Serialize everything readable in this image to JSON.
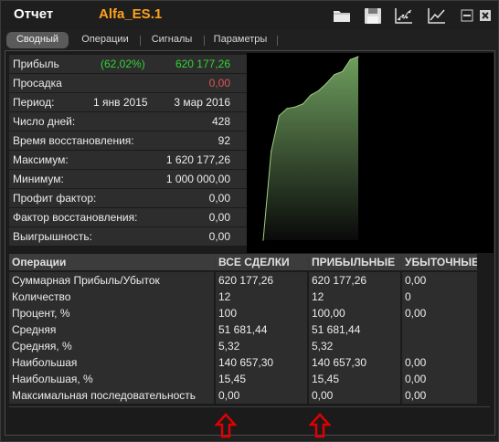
{
  "window": {
    "title": "Отчет",
    "subtitle": "Alfa_ES.1"
  },
  "toolbar_icons": [
    "folder-icon",
    "save-icon",
    "scatter-chart-icon",
    "line-chart-icon"
  ],
  "tabs": [
    {
      "label": "Сводный",
      "active": true
    },
    {
      "label": "Операции",
      "active": false
    },
    {
      "label": "Сигналы",
      "active": false
    },
    {
      "label": "Параметры",
      "active": false
    }
  ],
  "summary": [
    {
      "label": "Прибыль",
      "mid": "(62,02%)",
      "value": "620 177,26",
      "style": "green"
    },
    {
      "label": "Просадка",
      "mid": "",
      "value": "0,00",
      "style": "red"
    },
    {
      "label": "Период:",
      "mid": "1 янв 2015",
      "value": "3 мар 2016",
      "style": ""
    },
    {
      "label": "Число дней:",
      "mid": "",
      "value": "428",
      "style": ""
    },
    {
      "label": "Время восстановления:",
      "mid": "",
      "value": "92",
      "style": ""
    },
    {
      "label": "Максимум:",
      "mid": "",
      "value": "1 620 177,26",
      "style": ""
    },
    {
      "label": "Минимум:",
      "mid": "",
      "value": "1 000 000,00",
      "style": ""
    },
    {
      "label": "Профит фактор:",
      "mid": "",
      "value": "0,00",
      "style": ""
    },
    {
      "label": "Фактор восстановления:",
      "mid": "",
      "value": "0,00",
      "style": ""
    },
    {
      "label": "Выигрышность:",
      "mid": "",
      "value": "0,00",
      "style": ""
    }
  ],
  "chart_data": {
    "type": "area",
    "values": [
      1000000,
      1300000,
      1420000,
      1445000,
      1450000,
      1460000,
      1490000,
      1505000,
      1530000,
      1560000,
      1570000,
      1610000,
      1620177
    ],
    "ylim": [
      1000000,
      1620177
    ],
    "grid": false,
    "colors": {
      "fill_top": "#6e9e5e",
      "fill_bottom": "#0a0a0a",
      "line": "#9fd080"
    }
  },
  "operations": {
    "headers": [
      "Операции",
      "ВСЕ СДЕЛКИ",
      "ПРИБЫЛЬНЫЕ",
      "УБЫТОЧНЫЕ"
    ],
    "rows": [
      [
        "Суммарная Прибыль/Убыток",
        "620 177,26",
        "620 177,26",
        "0,00"
      ],
      [
        "Количество",
        "12",
        "12",
        "0"
      ],
      [
        "Процент, %",
        "100",
        "100,00",
        "0,00"
      ],
      [
        "Средняя",
        "51 681,44",
        "51 681,44",
        ""
      ],
      [
        "Средняя, %",
        "5,32",
        "5,32",
        ""
      ],
      [
        "Наибольшая",
        "140 657,30",
        "140 657,30",
        "0,00"
      ],
      [
        "Наибольшая, %",
        "15,45",
        "15,45",
        "0,00"
      ],
      [
        "Максимальная последовательность",
        "0,00",
        "0,00",
        "0,00"
      ]
    ]
  },
  "colors": {
    "accent": "#ffa21a",
    "profit": "#35d235",
    "loss": "#e05555",
    "annotation_arrow": "#e00000"
  }
}
